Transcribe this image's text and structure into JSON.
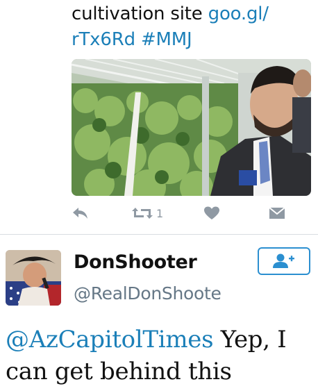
{
  "tweet_top": {
    "text_line1_prefix": "cultivation site ",
    "text_line1_link": "goo.gl/",
    "text_line2_link": "rTx6Rd",
    "text_line2_hashtag": "#MMJ",
    "retweet_count": "1"
  },
  "tweet_bottom": {
    "display_name": "DonShooter",
    "handle": "@RealDonShoote",
    "mention": "@AzCapitolTimes",
    "body_line1_rest": " Yep, I",
    "body_line2": "can get behind this"
  },
  "icons": {
    "reply": "reply-icon",
    "retweet": "retweet-icon",
    "like": "heart-icon",
    "message": "envelope-icon",
    "follow": "add-user-icon"
  },
  "colors": {
    "link": "#1b7fb8",
    "icon_gray": "#8f99a3",
    "follow_blue": "#2b8fd0",
    "handle_gray": "#657786"
  }
}
